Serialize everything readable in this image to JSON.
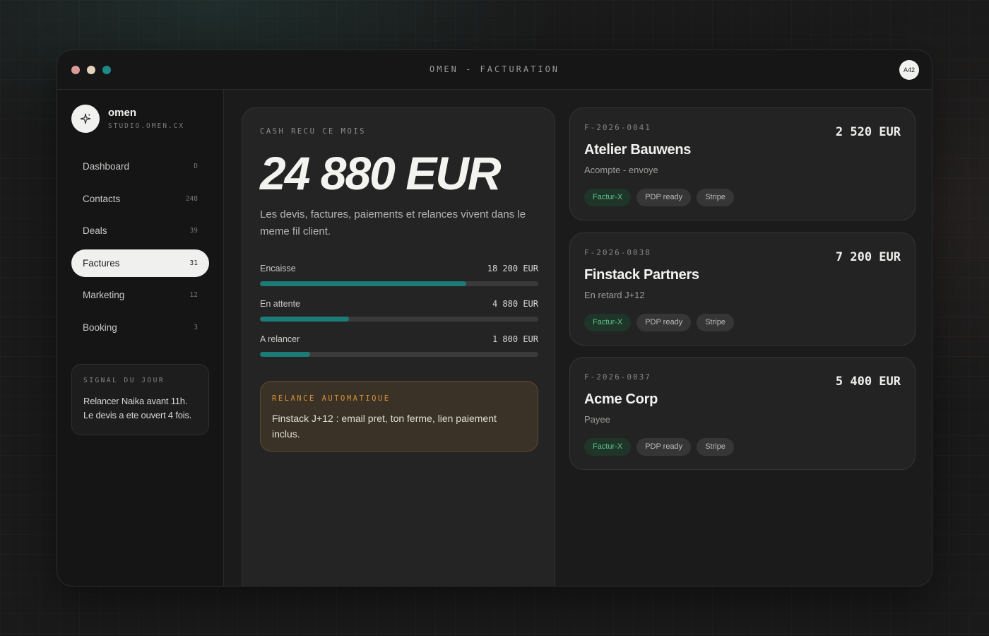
{
  "window": {
    "title": "OMEN - FACTURATION",
    "avatar": "A42"
  },
  "brand": {
    "name": "omen",
    "subtitle": "STUDIO.OMEN.CX",
    "logo_icon": "sparkle-icon"
  },
  "nav": [
    {
      "label": "Dashboard",
      "count": "D"
    },
    {
      "label": "Contacts",
      "count": "248"
    },
    {
      "label": "Deals",
      "count": "39"
    },
    {
      "label": "Factures",
      "count": "31",
      "active": true
    },
    {
      "label": "Marketing",
      "count": "12"
    },
    {
      "label": "Booking",
      "count": "3"
    }
  ],
  "signal": {
    "label": "SIGNAL DU JOUR",
    "line1": "Relancer Naika avant 11h.",
    "line2": "Le devis a ete ouvert 4 fois."
  },
  "cash": {
    "label": "CASH RECU CE MOIS",
    "value": "24 880 EUR",
    "description": "Les devis, factures, paiements et relances vivent dans le meme fil client.",
    "bars": [
      {
        "label": "Encaisse",
        "amount": "18 200 EUR",
        "fraction": 0.74
      },
      {
        "label": "En attente",
        "amount": "4 880 EUR",
        "fraction": 0.32
      },
      {
        "label": "A relancer",
        "amount": "1 800 EUR",
        "fraction": 0.18
      }
    ],
    "relance": {
      "label": "RELANCE AUTOMATIQUE",
      "text": "Finstack J+12 : email pret, ton ferme, lien paiement inclus."
    }
  },
  "invoices": [
    {
      "code": "F-2026-0041",
      "amount": "2 520 EUR",
      "client": "Atelier Bauwens",
      "status": "Acompte - envoye",
      "tags": [
        "Factur-X",
        "PDP ready",
        "Stripe"
      ]
    },
    {
      "code": "F-2026-0038",
      "amount": "7 200 EUR",
      "client": "Finstack Partners",
      "status": "En retard J+12",
      "tags": [
        "Factur-X",
        "PDP ready",
        "Stripe"
      ]
    },
    {
      "code": "F-2026-0037",
      "amount": "5 400 EUR",
      "client": "Acme Corp",
      "status": "Payee",
      "tags": [
        "Factur-X",
        "PDP ready",
        "Stripe"
      ]
    }
  ],
  "colors": {
    "accent": "#1a7b77",
    "relance": "#d8913a",
    "tag_green": "#5ec48b"
  }
}
